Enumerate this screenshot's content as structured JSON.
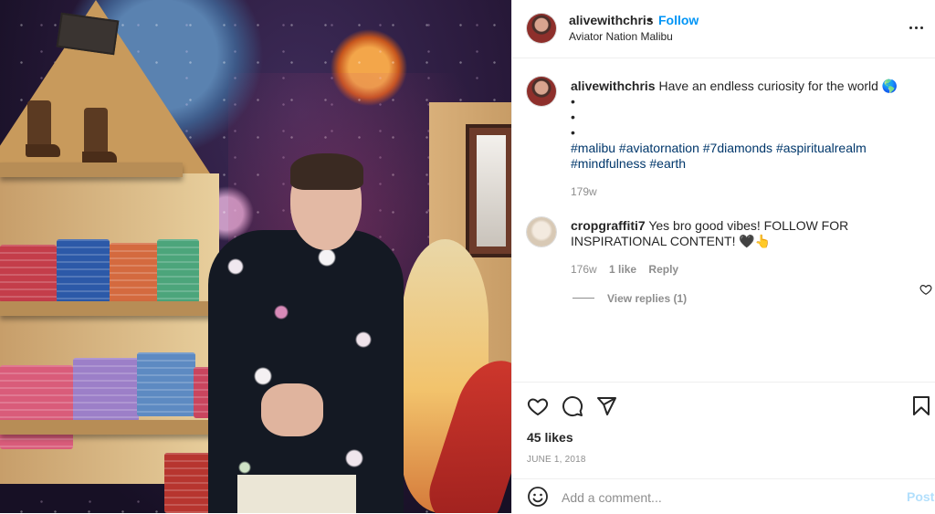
{
  "post": {
    "username": "alivewithchris",
    "separator": "•",
    "follow_label": "Follow",
    "location": "Aviator Nation Malibu",
    "more_icon": "more-horizontal-icon"
  },
  "caption": {
    "username": "alivewithchris",
    "text": "Have an endless curiosity for the world 🌎",
    "bullets": [
      "•",
      "•",
      "•"
    ],
    "hashtags": [
      "#malibu",
      "#aviatornation",
      "#7diamonds",
      "#aspiritualrealm",
      "#mindfulness",
      "#earth"
    ],
    "age": "179w"
  },
  "comment": {
    "username": "cropgraffiti7",
    "text_line1": "Yes bro good vibes! FOLLOW FOR",
    "text_line2": "INSPIRATIONAL CONTENT! 🖤👆",
    "age": "176w",
    "likes": "1 like",
    "reply_label": "Reply",
    "view_replies": "View replies (1)"
  },
  "actions": {
    "like_icon": "heart-icon",
    "comment_icon": "comment-icon",
    "share_icon": "share-icon",
    "save_icon": "bookmark-icon",
    "likes_count": "45 likes",
    "date": "June 1, 2018"
  },
  "add_comment": {
    "placeholder": "Add a comment...",
    "emoji_icon": "emoji-icon",
    "post_label": "Post"
  },
  "colors": {
    "link_blue": "#0095f6",
    "hashtag_blue": "#00376b",
    "muted": "#8e8e8e",
    "post_disabled": "#b2dffc"
  }
}
